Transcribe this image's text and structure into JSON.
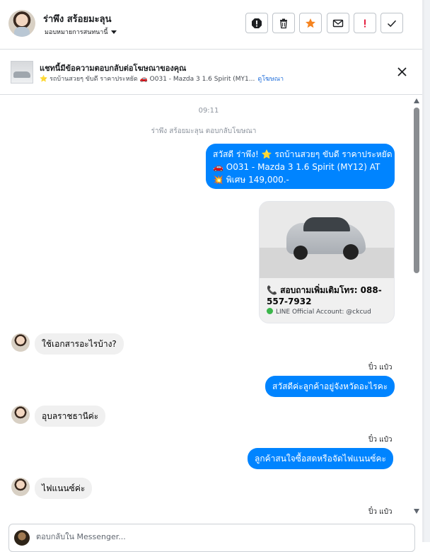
{
  "header": {
    "contact_name": "ร่าพึง สร้อยมะลุน",
    "assign_label": "มอบหมายการสนทนานี้",
    "actions": [
      "spam-icon",
      "trash-icon",
      "star-icon",
      "mail-icon",
      "flag-icon",
      "check-icon"
    ],
    "star_color": "#f5831f",
    "alert_color": "#e41e3f"
  },
  "ad_bar": {
    "title": "แชทนี้มีข้อความตอบกลับต่อโฆษณาของคุณ",
    "ad_text": "⭐ รถบ้านสวยๆ ขับดี ราคาประหยัด 🚗 O031 - Mazda 3 1.6 Spirit (MY1...",
    "view_ad_link": "ดูโฆษณา"
  },
  "chat": {
    "time": "09:11",
    "reply_notice": "ร่าพึง สร้อยมะลุน ตอบกลับโฆษณา",
    "greeting_line1": "สวัสดี ร่าพึง! ⭐ รถบ้านสวยๆ ขับดี ราคาประหยัด",
    "greeting_line2": "🚗 O031 - Mazda 3 1.6 Spirit (MY12) AT",
    "greeting_line3": "💥 พิเศษ 149,000.-",
    "card_contact": "📞 สอบถามเพิ่มเติมโทร: 088-557-7932",
    "card_line_account": "LINE Official Account: @ckcud",
    "msg_in_1": "ใช้เอกสารอะไรบ้าง?",
    "seen_1": "ปิ๋ว แป๋ว",
    "msg_out_1": "สวัสดีค่ะลูกค้าอยู่จังหวัดอะไรคะ",
    "msg_in_2": "อุบลราชธานีค่ะ",
    "seen_2": "ปิ๋ว แป๋ว",
    "msg_out_2": "ลูกค้าสนใจซื้อสดหรือจัดไฟแนนซ์คะ",
    "msg_in_3": "ไฟแนนซ์ค่ะ",
    "seen_3": "ปิ๋ว แป๋ว",
    "bubble_color": "#0084ff"
  },
  "composer": {
    "placeholder": "ตอบกลับใน Messenger..."
  }
}
